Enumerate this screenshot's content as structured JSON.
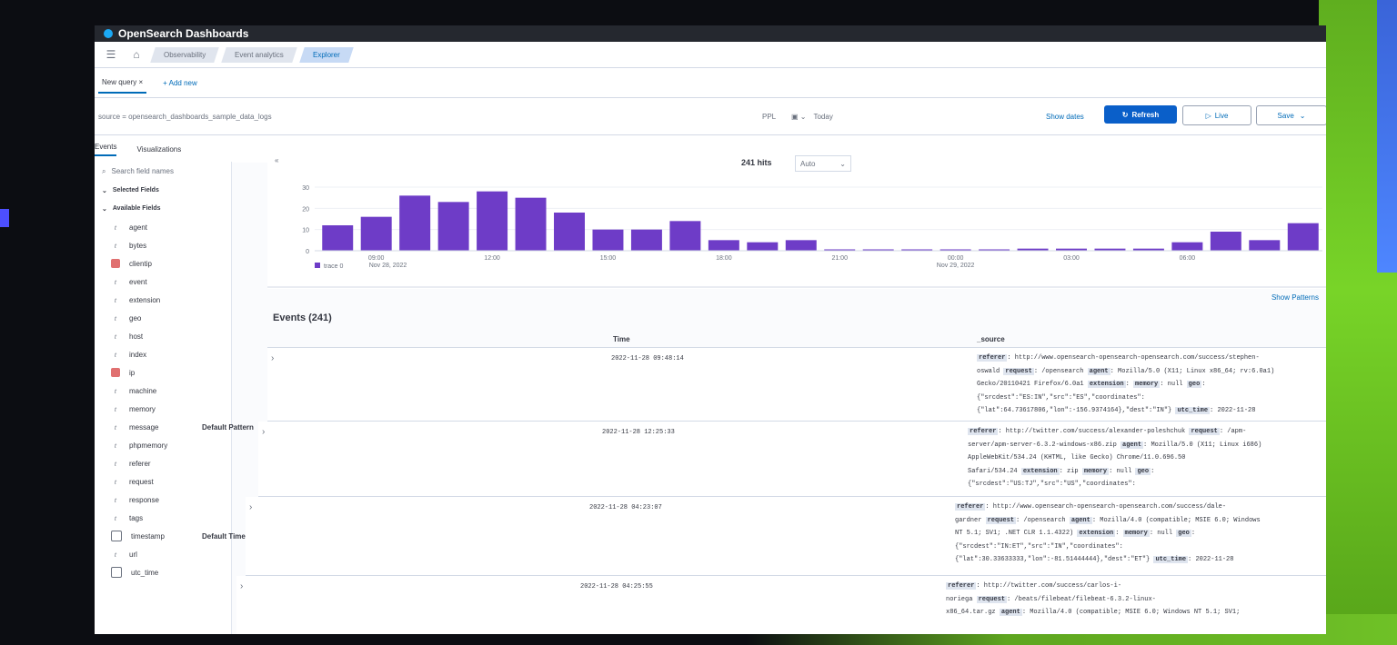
{
  "app": {
    "title": "OpenSearch Dashboards"
  },
  "breadcrumbs": [
    "Observability",
    "Event analytics",
    "Explorer"
  ],
  "tabs": {
    "query_tab": "New query",
    "add_new": "+ Add new"
  },
  "query": {
    "text": "source = opensearch_dashboards_sample_data_logs",
    "language": "PPL",
    "date": "Today",
    "show_dates": "Show dates",
    "refresh": "Refresh",
    "live": "Live",
    "save": "Save"
  },
  "view_tabs": [
    "Events",
    "Visualizations"
  ],
  "sidebar": {
    "search_placeholder": "Search field names",
    "selected_fields": "Selected Fields",
    "available_fields": "Available Fields",
    "fields": [
      {
        "name": "agent",
        "type": "t"
      },
      {
        "name": "bytes",
        "type": "t"
      },
      {
        "name": "clientip",
        "type": "ip"
      },
      {
        "name": "event",
        "type": "t"
      },
      {
        "name": "extension",
        "type": "t"
      },
      {
        "name": "geo",
        "type": "t"
      },
      {
        "name": "host",
        "type": "t"
      },
      {
        "name": "index",
        "type": "t"
      },
      {
        "name": "ip",
        "type": "ip"
      },
      {
        "name": "machine",
        "type": "t"
      },
      {
        "name": "memory",
        "type": "t"
      },
      {
        "name": "message",
        "type": "t",
        "tag": "Default Pattern"
      },
      {
        "name": "phpmemory",
        "type": "t"
      },
      {
        "name": "referer",
        "type": "t"
      },
      {
        "name": "request",
        "type": "t"
      },
      {
        "name": "response",
        "type": "t"
      },
      {
        "name": "tags",
        "type": "t"
      },
      {
        "name": "timestamp",
        "type": "date",
        "tag": "Default Timestamp"
      },
      {
        "name": "url",
        "type": "t"
      },
      {
        "name": "utc_time",
        "type": "date"
      }
    ]
  },
  "histogram": {
    "hits": "241 hits",
    "interval": "Auto",
    "legend": "trace 0",
    "color": "#6e3cc7",
    "y_ticks": [
      "0",
      "10",
      "20",
      "30"
    ],
    "x_labels": [
      "09:00",
      "12:00",
      "15:00",
      "18:00",
      "21:00",
      "00:00",
      "03:00",
      "06:00"
    ],
    "date_labels": [
      "Nov 28, 2022",
      "Nov 29, 2022"
    ]
  },
  "chart_data": {
    "type": "bar",
    "ylim": [
      0,
      30
    ],
    "series": [
      {
        "name": "trace 0",
        "values": [
          12,
          16,
          26,
          23,
          28,
          25,
          18,
          10,
          10,
          14,
          5,
          4,
          5,
          0,
          0,
          0,
          0,
          0,
          1,
          1,
          1,
          1,
          4,
          9,
          5,
          13
        ]
      }
    ]
  },
  "events": {
    "show_patterns": "Show Patterns",
    "title": "Events (241)",
    "columns": [
      "Time",
      "_source"
    ],
    "rows": [
      {
        "time": "2022-11-28 09:48:14",
        "source": [
          [
            [
              "k",
              "referer"
            ],
            [
              "v",
              ": http://www.opensearch-opensearch-opensearch.com/success/stephen-"
            ]
          ],
          [
            [
              "v",
              "oswald "
            ],
            [
              "k",
              "request"
            ],
            [
              "v",
              ": /opensearch "
            ],
            [
              "k",
              "agent"
            ],
            [
              "v",
              ": Mozilla/5.0 (X11; Linux x86_64; rv:6.0a1)"
            ]
          ],
          [
            [
              "v",
              "Gecko/20110421 Firefox/6.0a1 "
            ],
            [
              "k",
              "extension"
            ],
            [
              "v",
              ":  "
            ],
            [
              "k",
              "memory"
            ],
            [
              "v",
              ": null "
            ],
            [
              "k",
              "geo"
            ],
            [
              "v",
              ":"
            ]
          ],
          [
            [
              "v",
              "{\"srcdest\":\"ES:IN\",\"src\":\"ES\",\"coordinates\":"
            ]
          ],
          [
            [
              "v",
              "{\"lat\":64.73617806,\"lon\":-156.9374164},\"dest\":\"IN\"} "
            ],
            [
              "k",
              "utc_time"
            ],
            [
              "v",
              ": 2022-11-28"
            ]
          ]
        ]
      },
      {
        "time": "2022-11-28 12:25:33",
        "source": [
          [
            [
              "k",
              "referer"
            ],
            [
              "v",
              ": http://twitter.com/success/alexander-poleshchuk "
            ],
            [
              "k",
              "request"
            ],
            [
              "v",
              ": /apm-"
            ]
          ],
          [
            [
              "v",
              "server/apm-server-6.3.2-windows-x86.zip "
            ],
            [
              "k",
              "agent"
            ],
            [
              "v",
              ": Mozilla/5.0 (X11; Linux i686)"
            ]
          ],
          [
            [
              "v",
              "AppleWebKit/534.24 (KHTML, like Gecko) Chrome/11.0.696.50"
            ]
          ],
          [
            [
              "v",
              "Safari/534.24 "
            ],
            [
              "k",
              "extension"
            ],
            [
              "v",
              ": zip "
            ],
            [
              "k",
              "memory"
            ],
            [
              "v",
              ": null "
            ],
            [
              "k",
              "geo"
            ],
            [
              "v",
              ":"
            ]
          ],
          [
            [
              "v",
              "{\"srcdest\":\"US:TJ\",\"src\":\"US\",\"coordinates\":"
            ]
          ]
        ]
      },
      {
        "time": "2022-11-28 04:23:07",
        "source": [
          [
            [
              "k",
              "referer"
            ],
            [
              "v",
              ": http://www.opensearch-opensearch-opensearch.com/success/dale-"
            ]
          ],
          [
            [
              "v",
              "gardner "
            ],
            [
              "k",
              "request"
            ],
            [
              "v",
              ": /opensearch "
            ],
            [
              "k",
              "agent"
            ],
            [
              "v",
              ": Mozilla/4.0 (compatible; MSIE 6.0; Windows"
            ]
          ],
          [
            [
              "v",
              "NT 5.1; SV1; .NET CLR 1.1.4322) "
            ],
            [
              "k",
              "extension"
            ],
            [
              "v",
              ":  "
            ],
            [
              "k",
              "memory"
            ],
            [
              "v",
              ": null "
            ],
            [
              "k",
              "geo"
            ],
            [
              "v",
              ":"
            ]
          ],
          [
            [
              "v",
              "{\"srcdest\":\"IN:ET\",\"src\":\"IN\",\"coordinates\":"
            ]
          ],
          [
            [
              "v",
              "{\"lat\":30.33633333,\"lon\":-81.51444444},\"dest\":\"ET\"} "
            ],
            [
              "k",
              "utc_time"
            ],
            [
              "v",
              ": 2022-11-28"
            ]
          ]
        ]
      },
      {
        "time": "2022-11-28 04:25:55",
        "source": [
          [
            [
              "k",
              "referer"
            ],
            [
              "v",
              ": http://twitter.com/success/carlos-i-"
            ]
          ],
          [
            [
              "v",
              "noriega "
            ],
            [
              "k",
              "request"
            ],
            [
              "v",
              ": /beats/filebeat/filebeat-6.3.2-linux-"
            ]
          ],
          [
            [
              "v",
              "x86_64.tar.gz "
            ],
            [
              "k",
              "agent"
            ],
            [
              "v",
              ": Mozilla/4.0 (compatible; MSIE 6.0; Windows NT 5.1; SV1;"
            ]
          ]
        ]
      }
    ]
  }
}
